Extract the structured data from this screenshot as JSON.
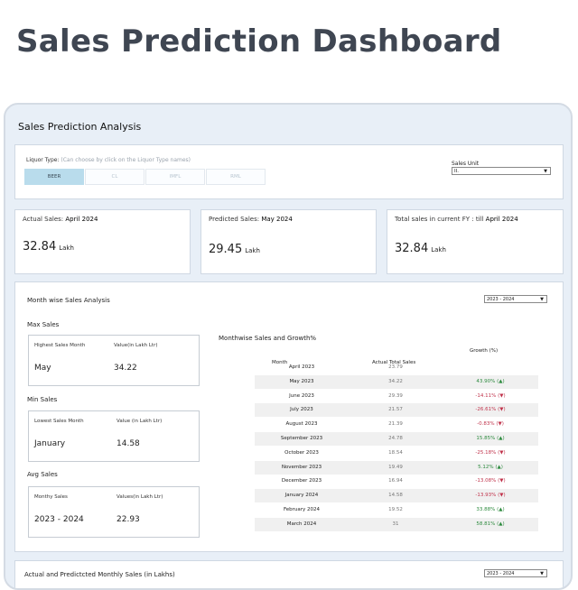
{
  "page_title": "Sales Prediction Dashboard",
  "analysis_title": "Sales Prediction Analysis",
  "filter": {
    "label": "Liquor Type:",
    "hint": "(Can choose by click on the Liquor Type names)",
    "options": [
      "BEER",
      "CL",
      "IMFL",
      "RML"
    ],
    "selected": "BEER",
    "unit_label": "Sales Unit",
    "unit_value": "II."
  },
  "kpis": {
    "actual": {
      "label": "Actual Sales:",
      "period": "April 2024",
      "value": "32.84",
      "unit": "Lakh"
    },
    "predicted": {
      "label": "Predicted Sales:",
      "period": "May 2024",
      "value": "29.45",
      "unit": "Lakh"
    },
    "total": {
      "label": "Total sales in current FY : till",
      "period": "April 2024",
      "value": "32.84",
      "unit": "Lakh"
    }
  },
  "monthwise": {
    "title": "Month wise Sales Analysis",
    "year": "2023 - 2024",
    "max": {
      "title": "Max Sales",
      "h1": "Highest Sales Month",
      "h2": "Value(in Lakh Ltr)",
      "v1": "May",
      "v2": "34.22"
    },
    "min": {
      "title": "Min Sales",
      "h1": "Lowest Sales Month",
      "h2": "Value (in Lakh Ltr)",
      "v1": "January",
      "v2": "14.58"
    },
    "avg": {
      "title": "Avg Sales",
      "h1": "Monthy Sales",
      "h2": "Values(in Lakh Ltr)",
      "v1": "2023 - 2024",
      "v2": "22.93"
    }
  },
  "growth_table": {
    "title": "Monthwise Sales and Growth%",
    "headers": {
      "month": "Month",
      "actual": "Actual Total Sales",
      "growth": "Growth (%)"
    },
    "rows": [
      {
        "month": "April 2023",
        "actual": "23.79",
        "growth": "",
        "dir": ""
      },
      {
        "month": "May 2023",
        "actual": "34.22",
        "growth": "43.90% (▲)",
        "dir": "up"
      },
      {
        "month": "June 2023",
        "actual": "29.39",
        "growth": "-14.11% (▼)",
        "dir": "down"
      },
      {
        "month": "July 2023",
        "actual": "21.57",
        "growth": "-26.61% (▼)",
        "dir": "down"
      },
      {
        "month": "August 2023",
        "actual": "21.39",
        "growth": "-0.83% (▼)",
        "dir": "down"
      },
      {
        "month": "September 2023",
        "actual": "24.78",
        "growth": "15.85% (▲)",
        "dir": "up"
      },
      {
        "month": "October 2023",
        "actual": "18.54",
        "growth": "-25.18% (▼)",
        "dir": "down"
      },
      {
        "month": "November 2023",
        "actual": "19.49",
        "growth": "5.12% (▲)",
        "dir": "up"
      },
      {
        "month": "December 2023",
        "actual": "16.94",
        "growth": "-13.08% (▼)",
        "dir": "down"
      },
      {
        "month": "January 2024",
        "actual": "14.58",
        "growth": "-13.93% (▼)",
        "dir": "down"
      },
      {
        "month": "February 2024",
        "actual": "19.52",
        "growth": "33.88% (▲)",
        "dir": "up"
      },
      {
        "month": "March 2024",
        "actual": "31",
        "growth": "58.81% (▲)",
        "dir": "up"
      }
    ]
  },
  "bottom": {
    "title": "Actual and Predictcted Monthly Sales (in Lakhs)",
    "year": "2023 - 2024"
  },
  "colors": {
    "up": "#2d8a3e",
    "down": "#c0334b",
    "active_tab": "#b9dcec"
  }
}
